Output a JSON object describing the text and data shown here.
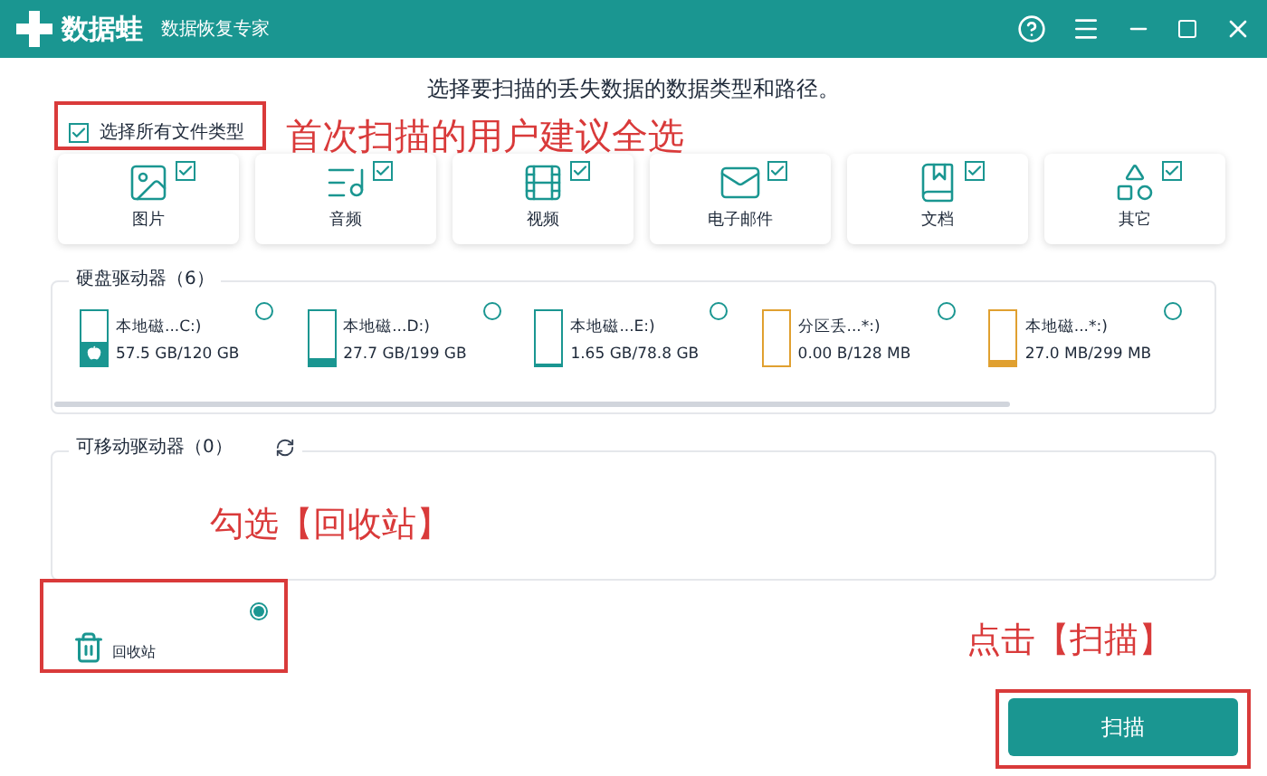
{
  "window": {
    "app_name": "数据蛙",
    "subtitle": "数据恢复专家"
  },
  "instruction": "选择要扫描的丢失数据的数据类型和路径。",
  "select_all": {
    "label": "选择所有文件类型",
    "checked": true
  },
  "file_types": [
    {
      "label": "图片",
      "kind": "image",
      "checked": true
    },
    {
      "label": "音频",
      "kind": "audio",
      "checked": true
    },
    {
      "label": "视频",
      "kind": "video",
      "checked": true
    },
    {
      "label": "电子邮件",
      "kind": "email",
      "checked": true
    },
    {
      "label": "文档",
      "kind": "document",
      "checked": true
    },
    {
      "label": "其它",
      "kind": "other",
      "checked": true
    }
  ],
  "hard_drives": {
    "title": "硬盘驱动器（6）",
    "drives": [
      {
        "name": "本地磁...C:)",
        "size": "57.5 GB/120 GB",
        "level": 0.45,
        "color": "#1a9691",
        "system": true,
        "selected": false
      },
      {
        "name": "本地磁...D:)",
        "size": "27.7 GB/199 GB",
        "level": 0.14,
        "color": "#1a9691",
        "system": false,
        "selected": false
      },
      {
        "name": "本地磁...E:)",
        "size": "1.65 GB/78.8 GB",
        "level": 0.03,
        "color": "#1a9691",
        "system": false,
        "selected": false
      },
      {
        "name": "分区丢...*:)",
        "size": "0.00  B/128 MB",
        "level": 0,
        "color": "#e0a030",
        "system": false,
        "selected": false
      },
      {
        "name": "本地磁...*:)",
        "size": "27.0 MB/299 MB",
        "level": 0.1,
        "color": "#e0a030",
        "system": false,
        "selected": false
      }
    ]
  },
  "removable_drives": {
    "title": "可移动驱动器（0）"
  },
  "recycle_bin": {
    "label": "回收站",
    "selected": true
  },
  "scan_button": "扫描",
  "annotations": [
    "首次扫描的用户建议全选",
    "勾选【回收站】",
    "点击【扫描】"
  ]
}
